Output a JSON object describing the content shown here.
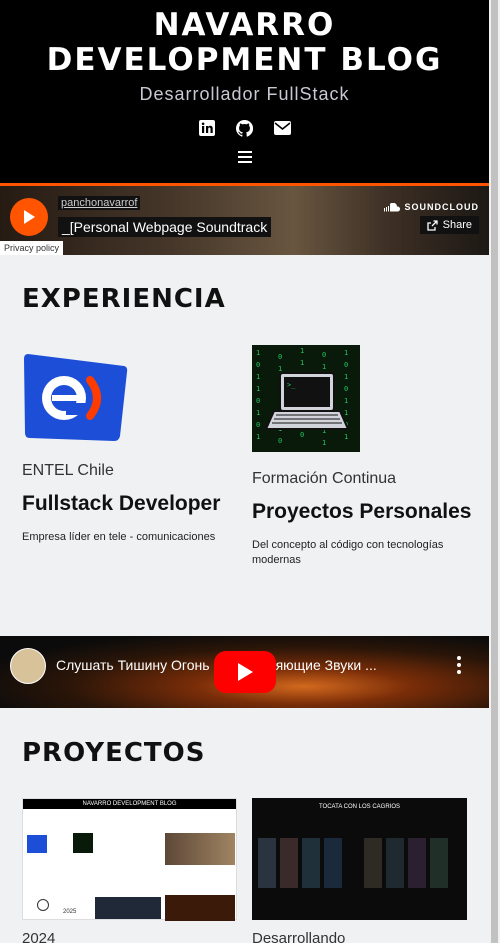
{
  "header": {
    "title_line1": "NAVARRO",
    "title_line2": "DEVELOPMENT BLOG",
    "subtitle": "Desarrollador FullStack",
    "social_icons": [
      "linkedin-icon",
      "github-icon",
      "envelope-icon"
    ],
    "menu_icon": "hamburger-icon"
  },
  "soundcloud": {
    "user": "panchonavarrof",
    "track": "_[Personal Webpage Soundtrack",
    "brand": "SOUNDCLOUD",
    "share_label": "Share",
    "privacy_label": "Privacy policy",
    "accent": "#ff5500"
  },
  "experience": {
    "heading": "EXPERIENCIA",
    "cards": [
      {
        "org": "ENTEL Chile",
        "role": "Fullstack Developer",
        "description": "Empresa líder en tele - comunicaciones"
      },
      {
        "org": "Formación Continua",
        "role": "Proyectos Personales",
        "description": "Del concepto al código con tecnologías modernas"
      }
    ]
  },
  "video": {
    "title": "Слушать Тишину Огонь Расслабляющие Звуки ..."
  },
  "projects": {
    "heading": "PROYECTOS",
    "items": [
      {
        "label": "2024",
        "thumb_title": "NAVARRO DEVELOPMENT BLOG",
        "thumb_year": "2025"
      },
      {
        "label": "Desarrollando",
        "thumb_title": "TOCATA CON LOS CAGRIOS"
      }
    ]
  }
}
